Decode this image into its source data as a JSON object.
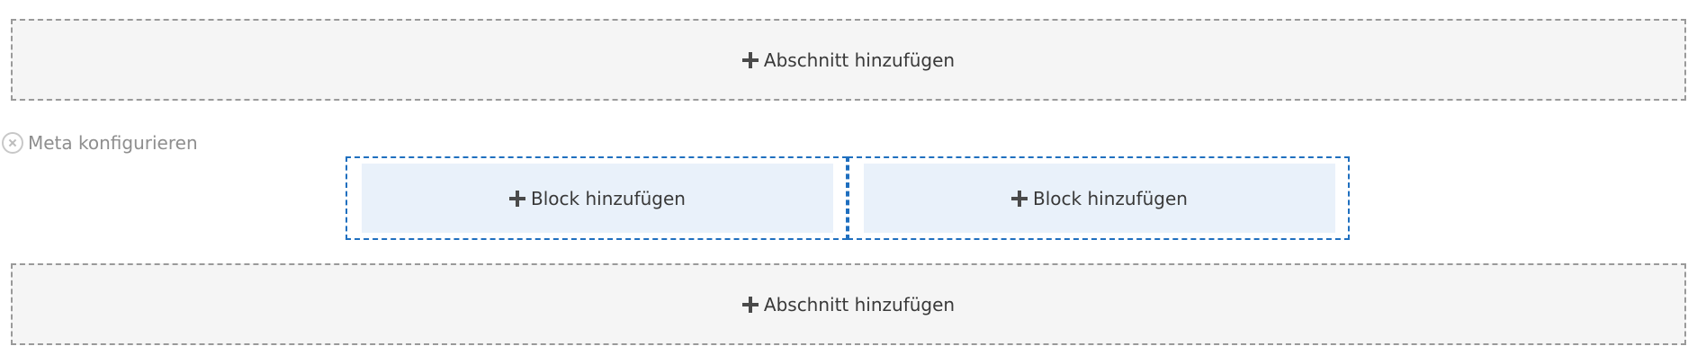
{
  "sections": {
    "top": {
      "label": "Abschnitt hinzufügen"
    },
    "bottom": {
      "label": "Abschnitt hinzufügen"
    }
  },
  "meta": {
    "label": "Meta konfigurieren",
    "icon": "close-circle-icon"
  },
  "columns": [
    {
      "label": "Block hinzufügen"
    },
    {
      "label": "Block hinzufügen"
    }
  ],
  "icons": {
    "add": "plus-icon"
  },
  "colors": {
    "section_background": "#f5f5f5",
    "section_border": "#9a9a9a",
    "column_border": "#1f6fbf",
    "block_background": "#e9f1fa",
    "meta_text": "#8e8e8e"
  }
}
